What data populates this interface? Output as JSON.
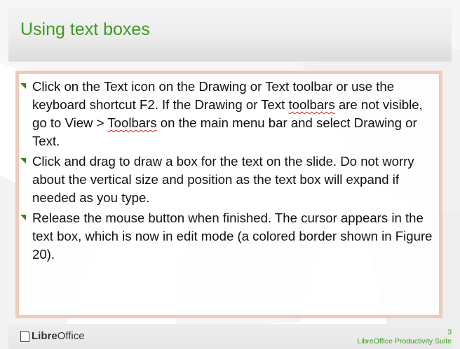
{
  "slide": {
    "title": "Using text boxes",
    "bullets": [
      {
        "segments": [
          {
            "text": "Click on the Text icon  on the Drawing or Text toolbar or use the keyboard shortcut F2. If the Drawing or Text "
          },
          {
            "text": "toolbars",
            "spellcheck": true
          },
          {
            "text": " are not visible, go to View > "
          },
          {
            "text": "Toolbars",
            "spellcheck": true
          },
          {
            "text": " on the main menu bar and select Drawing or Text."
          }
        ]
      },
      {
        "segments": [
          {
            "text": "Click and drag to draw a box for the text on the slide. Do not worry about the vertical size and position as the text box will expand if needed as you type."
          }
        ]
      },
      {
        "segments": [
          {
            "text": "Release the mouse button when finished. The cursor appears in the text box, which is now in edit mode (a colored border shown in Figure 20)."
          }
        ]
      }
    ]
  },
  "footer": {
    "logo_bold": "Libre",
    "logo_regular": "Office",
    "page_number": "3",
    "product_text": "LibreOffice Productivity Suite"
  },
  "colors": {
    "title": "#3f9a20",
    "bullet": "#2e8b1f",
    "text_box_border": "#efcbb9",
    "spellcheck_underline": "#d62020"
  }
}
